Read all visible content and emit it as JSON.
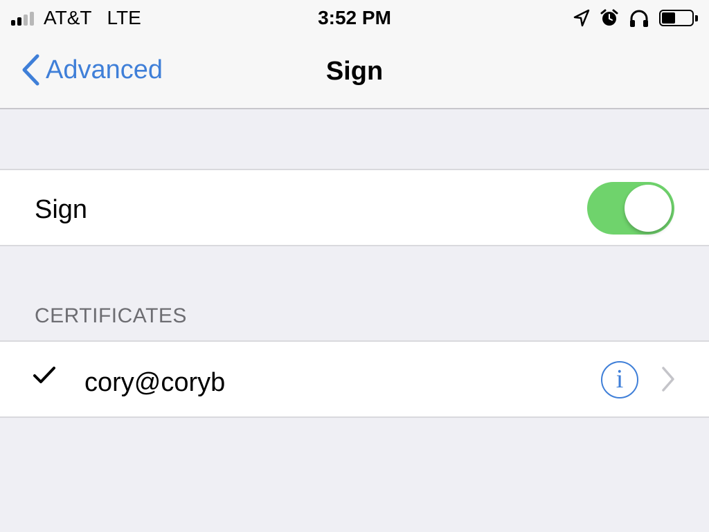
{
  "status_bar": {
    "carrier": "AT&T",
    "network": "LTE",
    "time": "3:52 PM",
    "icons": [
      "location-arrow-icon",
      "alarm-icon",
      "headphones-icon",
      "battery-icon"
    ],
    "signal_bars_filled": 2,
    "signal_bars_total": 4,
    "battery_level": 0.45
  },
  "nav": {
    "back_label": "Advanced",
    "title": "Sign",
    "accent_color": "#3f7fd8"
  },
  "sign_cell": {
    "label": "Sign",
    "toggle_on": true,
    "toggle_color": "#6fd36c"
  },
  "certificates": {
    "header": "CERTIFICATES",
    "items": [
      {
        "selected": true,
        "email": "cory@coryb"
      }
    ]
  }
}
